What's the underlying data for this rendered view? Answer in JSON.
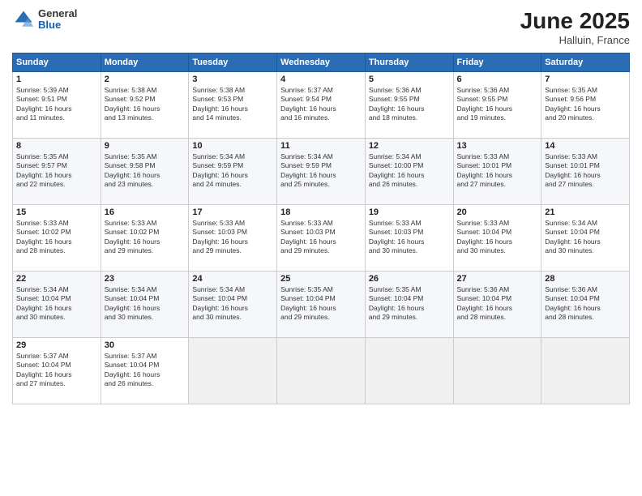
{
  "header": {
    "logo": {
      "general": "General",
      "blue": "Blue"
    },
    "title": "June 2025",
    "location": "Halluin, France"
  },
  "calendar": {
    "weekdays": [
      "Sunday",
      "Monday",
      "Tuesday",
      "Wednesday",
      "Thursday",
      "Friday",
      "Saturday"
    ],
    "weeks": [
      [
        null,
        null,
        null,
        null,
        null,
        null,
        null
      ]
    ],
    "days": [
      {
        "date": 1,
        "dow": 0,
        "sunrise": "5:39 AM",
        "sunset": "9:51 PM",
        "daylight": "16 hours and 11 minutes."
      },
      {
        "date": 2,
        "dow": 1,
        "sunrise": "5:38 AM",
        "sunset": "9:52 PM",
        "daylight": "16 hours and 13 minutes."
      },
      {
        "date": 3,
        "dow": 2,
        "sunrise": "5:38 AM",
        "sunset": "9:53 PM",
        "daylight": "16 hours and 14 minutes."
      },
      {
        "date": 4,
        "dow": 3,
        "sunrise": "5:37 AM",
        "sunset": "9:54 PM",
        "daylight": "16 hours and 16 minutes."
      },
      {
        "date": 5,
        "dow": 4,
        "sunrise": "5:36 AM",
        "sunset": "9:55 PM",
        "daylight": "16 hours and 18 minutes."
      },
      {
        "date": 6,
        "dow": 5,
        "sunrise": "5:36 AM",
        "sunset": "9:55 PM",
        "daylight": "16 hours and 19 minutes."
      },
      {
        "date": 7,
        "dow": 6,
        "sunrise": "5:35 AM",
        "sunset": "9:56 PM",
        "daylight": "16 hours and 20 minutes."
      },
      {
        "date": 8,
        "dow": 0,
        "sunrise": "5:35 AM",
        "sunset": "9:57 PM",
        "daylight": "16 hours and 22 minutes."
      },
      {
        "date": 9,
        "dow": 1,
        "sunrise": "5:35 AM",
        "sunset": "9:58 PM",
        "daylight": "16 hours and 23 minutes."
      },
      {
        "date": 10,
        "dow": 2,
        "sunrise": "5:34 AM",
        "sunset": "9:59 PM",
        "daylight": "16 hours and 24 minutes."
      },
      {
        "date": 11,
        "dow": 3,
        "sunrise": "5:34 AM",
        "sunset": "9:59 PM",
        "daylight": "16 hours and 25 minutes."
      },
      {
        "date": 12,
        "dow": 4,
        "sunrise": "5:34 AM",
        "sunset": "10:00 PM",
        "daylight": "16 hours and 26 minutes."
      },
      {
        "date": 13,
        "dow": 5,
        "sunrise": "5:33 AM",
        "sunset": "10:01 PM",
        "daylight": "16 hours and 27 minutes."
      },
      {
        "date": 14,
        "dow": 6,
        "sunrise": "5:33 AM",
        "sunset": "10:01 PM",
        "daylight": "16 hours and 27 minutes."
      },
      {
        "date": 15,
        "dow": 0,
        "sunrise": "5:33 AM",
        "sunset": "10:02 PM",
        "daylight": "16 hours and 28 minutes."
      },
      {
        "date": 16,
        "dow": 1,
        "sunrise": "5:33 AM",
        "sunset": "10:02 PM",
        "daylight": "16 hours and 29 minutes."
      },
      {
        "date": 17,
        "dow": 2,
        "sunrise": "5:33 AM",
        "sunset": "10:03 PM",
        "daylight": "16 hours and 29 minutes."
      },
      {
        "date": 18,
        "dow": 3,
        "sunrise": "5:33 AM",
        "sunset": "10:03 PM",
        "daylight": "16 hours and 29 minutes."
      },
      {
        "date": 19,
        "dow": 4,
        "sunrise": "5:33 AM",
        "sunset": "10:03 PM",
        "daylight": "16 hours and 30 minutes."
      },
      {
        "date": 20,
        "dow": 5,
        "sunrise": "5:33 AM",
        "sunset": "10:04 PM",
        "daylight": "16 hours and 30 minutes."
      },
      {
        "date": 21,
        "dow": 6,
        "sunrise": "5:34 AM",
        "sunset": "10:04 PM",
        "daylight": "16 hours and 30 minutes."
      },
      {
        "date": 22,
        "dow": 0,
        "sunrise": "5:34 AM",
        "sunset": "10:04 PM",
        "daylight": "16 hours and 30 minutes."
      },
      {
        "date": 23,
        "dow": 1,
        "sunrise": "5:34 AM",
        "sunset": "10:04 PM",
        "daylight": "16 hours and 30 minutes."
      },
      {
        "date": 24,
        "dow": 2,
        "sunrise": "5:34 AM",
        "sunset": "10:04 PM",
        "daylight": "16 hours and 30 minutes."
      },
      {
        "date": 25,
        "dow": 3,
        "sunrise": "5:35 AM",
        "sunset": "10:04 PM",
        "daylight": "16 hours and 29 minutes."
      },
      {
        "date": 26,
        "dow": 4,
        "sunrise": "5:35 AM",
        "sunset": "10:04 PM",
        "daylight": "16 hours and 29 minutes."
      },
      {
        "date": 27,
        "dow": 5,
        "sunrise": "5:36 AM",
        "sunset": "10:04 PM",
        "daylight": "16 hours and 28 minutes."
      },
      {
        "date": 28,
        "dow": 6,
        "sunrise": "5:36 AM",
        "sunset": "10:04 PM",
        "daylight": "16 hours and 28 minutes."
      },
      {
        "date": 29,
        "dow": 0,
        "sunrise": "5:37 AM",
        "sunset": "10:04 PM",
        "daylight": "16 hours and 27 minutes."
      },
      {
        "date": 30,
        "dow": 1,
        "sunrise": "5:37 AM",
        "sunset": "10:04 PM",
        "daylight": "16 hours and 26 minutes."
      }
    ]
  }
}
